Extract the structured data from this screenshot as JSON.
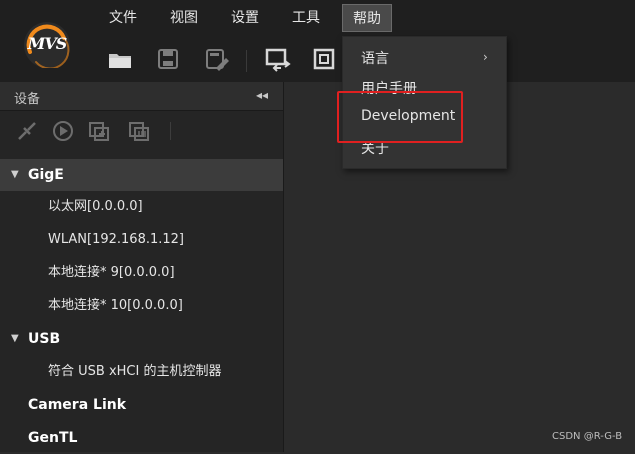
{
  "app": {
    "logo_text": "MVS"
  },
  "menubar": {
    "items": [
      {
        "label": "文件"
      },
      {
        "label": "视图"
      },
      {
        "label": "设置"
      },
      {
        "label": "工具"
      },
      {
        "label": "帮助",
        "active": true
      }
    ]
  },
  "toolbar": {
    "tools": [
      "open-folder-icon",
      "save-icon",
      "save-edit-icon",
      "screen-switch-icon",
      "window-icon"
    ]
  },
  "device_panel": {
    "title": "设备",
    "collapse_glyph": "◂◂",
    "tools": [
      "disconnect-icon",
      "play-icon",
      "record-icon",
      "multi-window-icon"
    ],
    "groups": [
      {
        "label": "GigE",
        "expanded": true,
        "selected": true,
        "items": [
          "以太网[0.0.0.0]",
          "WLAN[192.168.1.12]",
          "本地连接* 9[0.0.0.0]",
          "本地连接* 10[0.0.0.0]"
        ]
      },
      {
        "label": "USB",
        "expanded": true,
        "items": [
          "符合 USB xHCI 的主机控制器"
        ]
      },
      {
        "label": "Camera Link",
        "expanded": false,
        "items": []
      },
      {
        "label": "GenTL",
        "expanded": false,
        "items": []
      }
    ]
  },
  "help_menu": {
    "items": [
      {
        "label": "语言",
        "has_submenu": true
      },
      {
        "label": "用户手册"
      },
      {
        "label": "Development",
        "highlighted": true
      },
      {
        "label": "关于"
      }
    ],
    "submenu_glyph": "›"
  },
  "watermark": "CSDN @R-G-B",
  "colors": {
    "accent_orange": "#f08a1c",
    "highlight_red": "#e02020"
  }
}
